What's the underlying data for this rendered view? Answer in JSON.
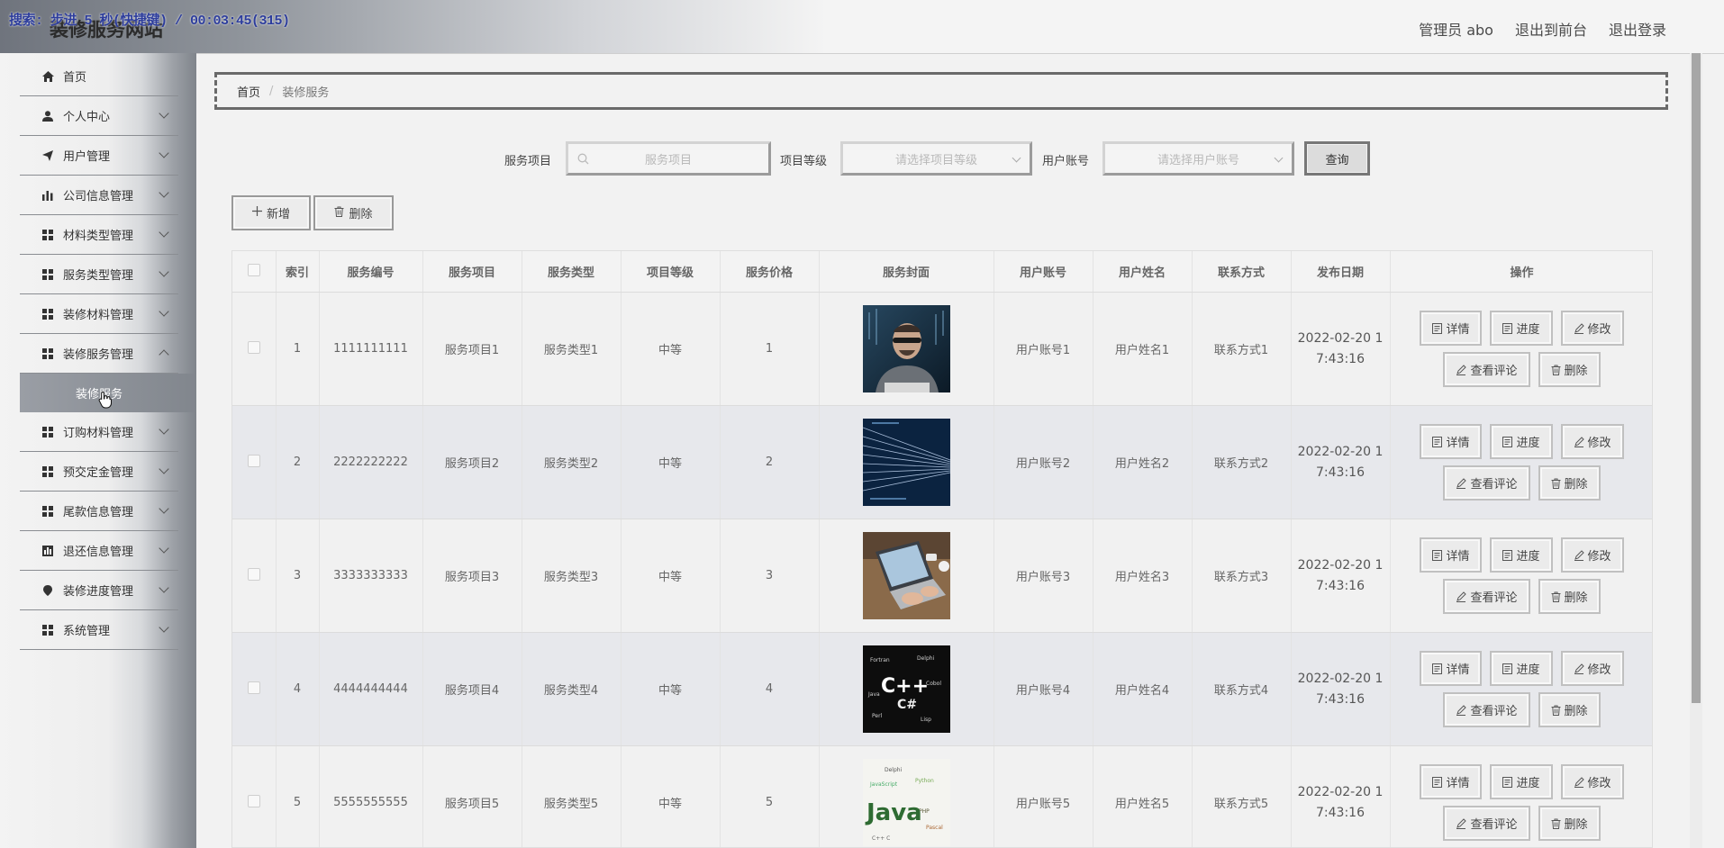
{
  "recording_overlay": "搜索: 步进 5 秒(快捷键) / 00:03:45(315)",
  "header": {
    "site_title": "装修服务网站",
    "nav": [
      "管理员 abo",
      "退出到前台",
      "退出登录"
    ]
  },
  "sidebar": {
    "items": [
      {
        "label": "首页",
        "icon": "home-icon"
      },
      {
        "label": "个人中心",
        "icon": "user-icon"
      },
      {
        "label": "用户管理",
        "icon": "send-icon"
      },
      {
        "label": "公司信息管理",
        "icon": "bar-chart-icon"
      },
      {
        "label": "材料类型管理",
        "icon": "grid-icon"
      },
      {
        "label": "服务类型管理",
        "icon": "grid-icon"
      },
      {
        "label": "装修材料管理",
        "icon": "grid-icon"
      },
      {
        "label": "装修服务管理",
        "icon": "grid-icon"
      },
      {
        "label": "订购材料管理",
        "icon": "grid-icon"
      },
      {
        "label": "预交定金管理",
        "icon": "grid-icon"
      },
      {
        "label": "尾款信息管理",
        "icon": "grid-icon"
      },
      {
        "label": "退还信息管理",
        "icon": "chart-box-icon"
      },
      {
        "label": "装修进度管理",
        "icon": "pin-icon"
      },
      {
        "label": "系统管理",
        "icon": "grid-icon"
      }
    ],
    "active_sub": "装修服务"
  },
  "breadcrumb": {
    "home": "首页",
    "separator": "/",
    "current": "装修服务"
  },
  "search": {
    "item_label": "服务项目",
    "item_placeholder": "服务项目",
    "level_label": "项目等级",
    "level_placeholder": "请选择项目等级",
    "account_label": "用户账号",
    "account_placeholder": "请选择用户账号",
    "query_button": "查询"
  },
  "toolbar": {
    "add": "新增",
    "delete": "删除"
  },
  "table": {
    "headers": [
      "索引",
      "服务编号",
      "服务项目",
      "服务类型",
      "项目等级",
      "服务价格",
      "服务封面",
      "用户账号",
      "用户姓名",
      "联系方式",
      "发布日期",
      "操作"
    ],
    "rows": [
      {
        "index": "1",
        "code": "1111111111",
        "item": "服务项目1",
        "type": "服务类型1",
        "level": "中等",
        "price": "1",
        "cover": "man-at-computer",
        "account": "用户账号1",
        "name": "用户姓名1",
        "contact": "联系方式1",
        "date1": "2022-02-20 1",
        "date2": "7:43:16"
      },
      {
        "index": "2",
        "code": "2222222222",
        "item": "服务项目2",
        "type": "服务类型2",
        "level": "中等",
        "price": "2",
        "cover": "code-wave",
        "account": "用户账号2",
        "name": "用户姓名2",
        "contact": "联系方式2",
        "date1": "2022-02-20 1",
        "date2": "7:43:16"
      },
      {
        "index": "3",
        "code": "3333333333",
        "item": "服务项目3",
        "type": "服务类型3",
        "level": "中等",
        "price": "3",
        "cover": "laptop-typing",
        "account": "用户账号3",
        "name": "用户姓名3",
        "contact": "联系方式3",
        "date1": "2022-02-20 1",
        "date2": "7:43:16"
      },
      {
        "index": "4",
        "code": "4444444444",
        "item": "服务项目4",
        "type": "服务类型4",
        "level": "中等",
        "price": "4",
        "cover": "cpp-word-cloud",
        "account": "用户账号4",
        "name": "用户姓名4",
        "contact": "联系方式4",
        "date1": "2022-02-20 1",
        "date2": "7:43:16"
      },
      {
        "index": "5",
        "code": "5555555555",
        "item": "服务项目5",
        "type": "服务类型5",
        "level": "中等",
        "price": "5",
        "cover": "java-word-cloud",
        "account": "用户账号5",
        "name": "用户姓名5",
        "contact": "联系方式5",
        "date1": "2022-02-20 1",
        "date2": "7:43:16"
      }
    ],
    "actions": {
      "detail": "详情",
      "progress": "进度",
      "edit": "修改",
      "comments": "查看评论",
      "delete": "删除"
    }
  },
  "colors": {
    "sidebar_active": "#8d9198",
    "accent_gray": "#777777"
  }
}
